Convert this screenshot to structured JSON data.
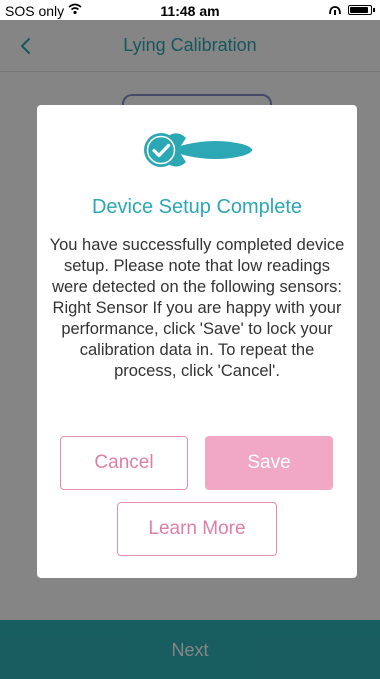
{
  "status_bar": {
    "carrier": "SOS only",
    "time": "11:48 am",
    "icons": [
      "wifi-icon",
      "signal-icon",
      "battery-icon"
    ]
  },
  "nav": {
    "title": "Lying Calibration",
    "back_icon": "chevron-left-icon"
  },
  "footer": {
    "next_label": "Next"
  },
  "modal": {
    "icon": "device-check-icon",
    "title": "Device Setup Complete",
    "message": "You have successfully completed device setup. Please note that low readings were detected on the following sensors: Right Sensor  If you are happy with your performance, click 'Save' to lock your calibration data in. To repeat the process, click 'Cancel'.",
    "cancel_label": "Cancel",
    "save_label": "Save",
    "learn_more_label": "Learn More"
  },
  "colors": {
    "accent_teal": "#2ca8b4",
    "footer_teal": "#2fb3b8",
    "pink": "#e07fa3",
    "pink_fill": "#f0a8c4"
  }
}
